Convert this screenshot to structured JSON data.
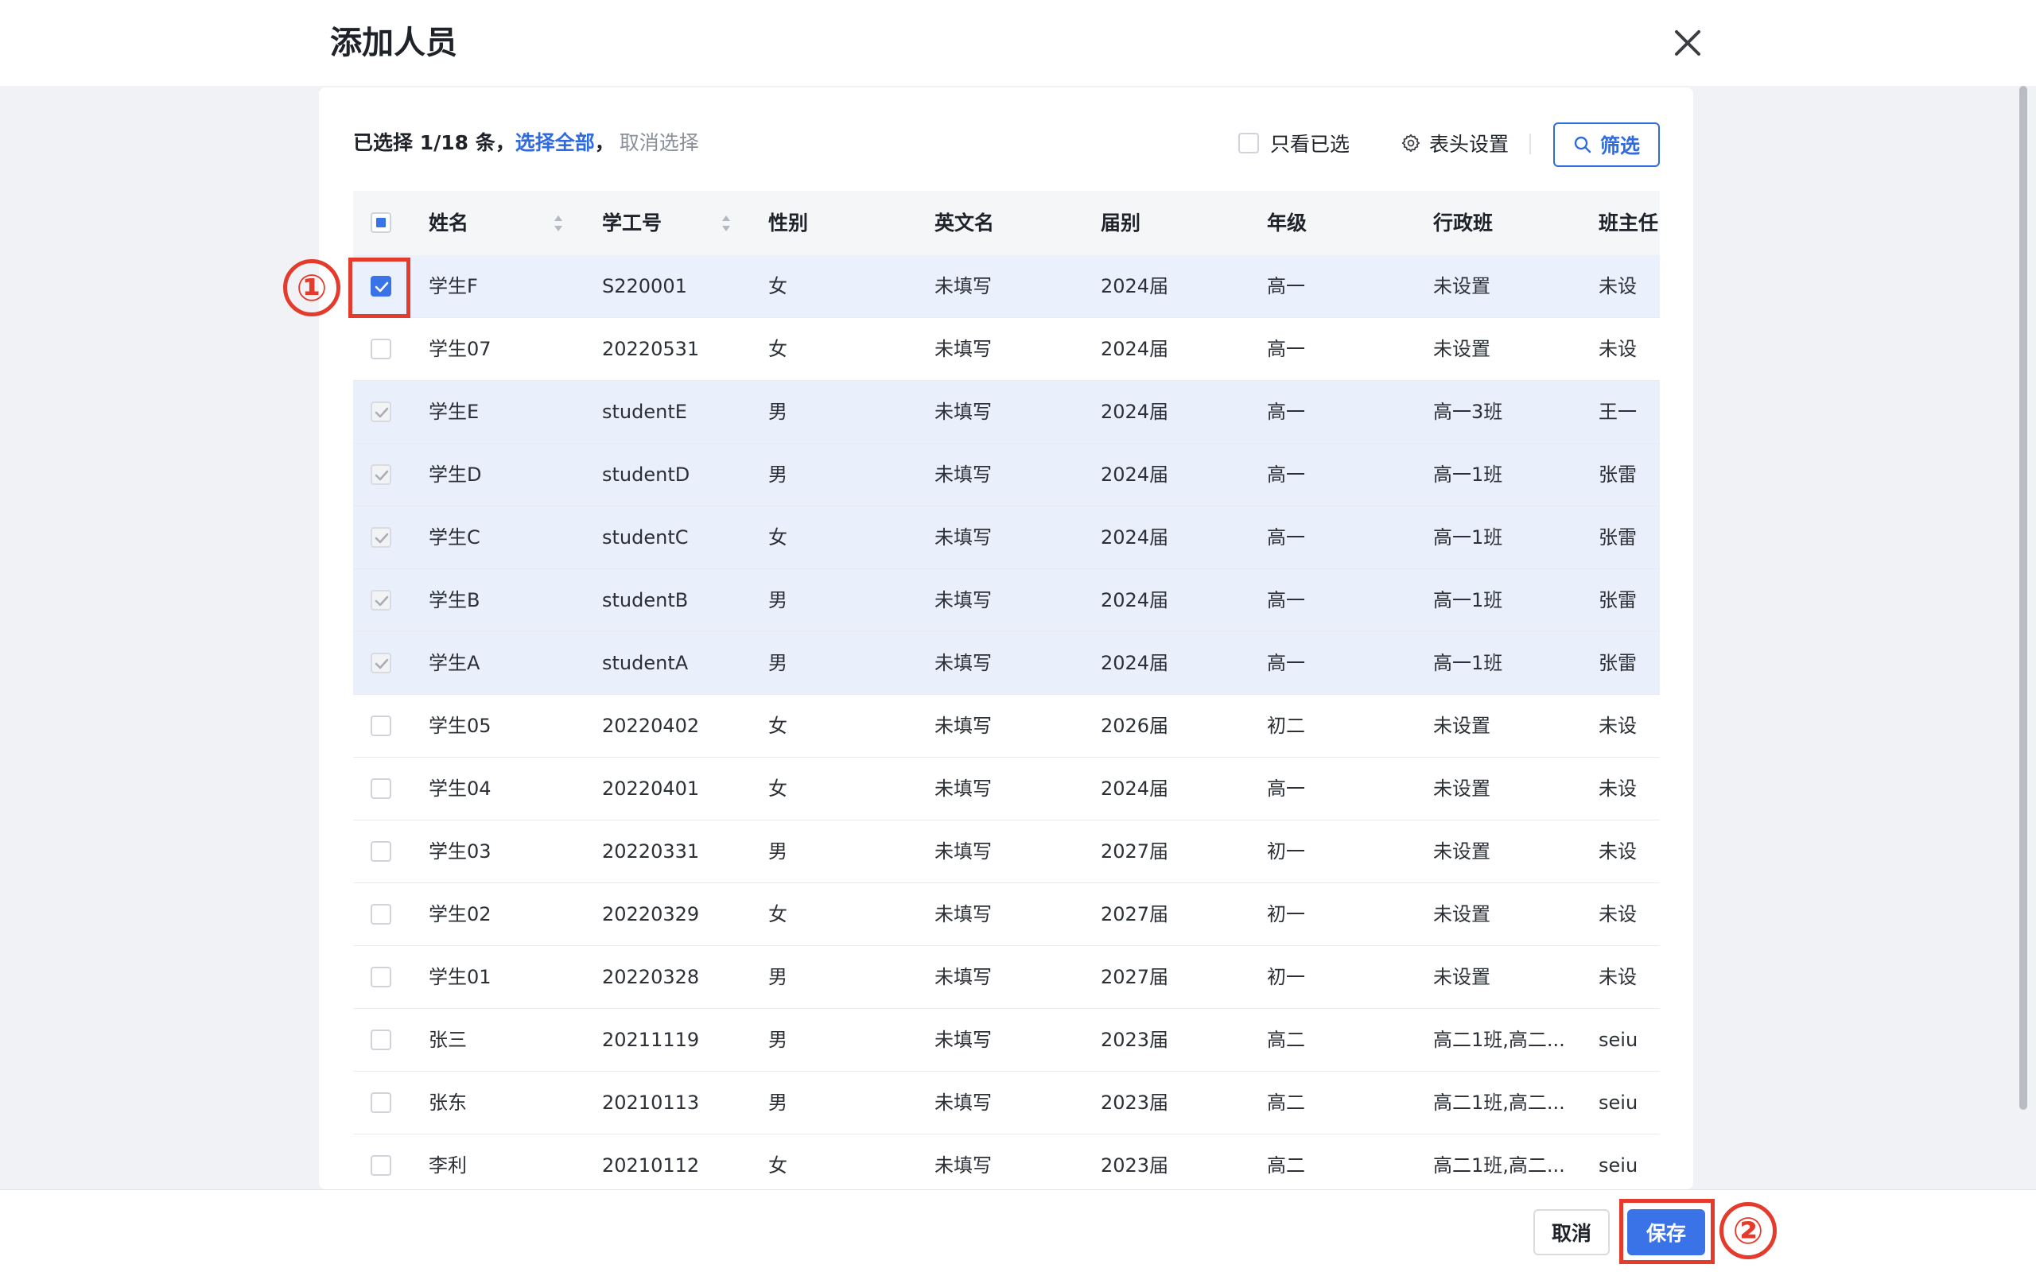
{
  "dialog": {
    "title": "添加人员",
    "close_icon": "close-icon"
  },
  "toolbar": {
    "selection_count": "已选择 1/18 条，",
    "select_all": "选择全部",
    "separator": "，",
    "clear_selection": "取消选择",
    "only_selected_label": "只看已选",
    "only_selected_checked": false,
    "header_settings_label": "表头设置",
    "header_settings_icon": "gear-icon",
    "filter_label": "筛选",
    "filter_icon": "search-icon"
  },
  "table": {
    "columns": [
      "姓名",
      "学工号",
      "性别",
      "英文名",
      "届别",
      "年级",
      "行政班",
      "班主任"
    ],
    "sortable_columns": [
      "姓名",
      "学工号"
    ],
    "header_checkbox_state": "partial",
    "rows": [
      {
        "state": "checked",
        "name": "学生F",
        "id": "S220001",
        "gender": "女",
        "english": "未填写",
        "cohort": "2024届",
        "grade": "高一",
        "class": "未设置",
        "teacher": "未设"
      },
      {
        "state": "unchecked",
        "name": "学生07",
        "id": "20220531",
        "gender": "女",
        "english": "未填写",
        "cohort": "2024届",
        "grade": "高一",
        "class": "未设置",
        "teacher": "未设"
      },
      {
        "state": "disabled",
        "name": "学生E",
        "id": "studentE",
        "gender": "男",
        "english": "未填写",
        "cohort": "2024届",
        "grade": "高一",
        "class": "高一3班",
        "teacher": "王一"
      },
      {
        "state": "disabled",
        "name": "学生D",
        "id": "studentD",
        "gender": "男",
        "english": "未填写",
        "cohort": "2024届",
        "grade": "高一",
        "class": "高一1班",
        "teacher": "张雷"
      },
      {
        "state": "disabled",
        "name": "学生C",
        "id": "studentC",
        "gender": "女",
        "english": "未填写",
        "cohort": "2024届",
        "grade": "高一",
        "class": "高一1班",
        "teacher": "张雷"
      },
      {
        "state": "disabled",
        "name": "学生B",
        "id": "studentB",
        "gender": "男",
        "english": "未填写",
        "cohort": "2024届",
        "grade": "高一",
        "class": "高一1班",
        "teacher": "张雷"
      },
      {
        "state": "disabled",
        "name": "学生A",
        "id": "studentA",
        "gender": "男",
        "english": "未填写",
        "cohort": "2024届",
        "grade": "高一",
        "class": "高一1班",
        "teacher": "张雷"
      },
      {
        "state": "unchecked",
        "name": "学生05",
        "id": "20220402",
        "gender": "女",
        "english": "未填写",
        "cohort": "2026届",
        "grade": "初二",
        "class": "未设置",
        "teacher": "未设"
      },
      {
        "state": "unchecked",
        "name": "学生04",
        "id": "20220401",
        "gender": "女",
        "english": "未填写",
        "cohort": "2024届",
        "grade": "高一",
        "class": "未设置",
        "teacher": "未设"
      },
      {
        "state": "unchecked",
        "name": "学生03",
        "id": "20220331",
        "gender": "男",
        "english": "未填写",
        "cohort": "2027届",
        "grade": "初一",
        "class": "未设置",
        "teacher": "未设"
      },
      {
        "state": "unchecked",
        "name": "学生02",
        "id": "20220329",
        "gender": "女",
        "english": "未填写",
        "cohort": "2027届",
        "grade": "初一",
        "class": "未设置",
        "teacher": "未设"
      },
      {
        "state": "unchecked",
        "name": "学生01",
        "id": "20220328",
        "gender": "男",
        "english": "未填写",
        "cohort": "2027届",
        "grade": "初一",
        "class": "未设置",
        "teacher": "未设"
      },
      {
        "state": "unchecked",
        "name": "张三",
        "id": "20211119",
        "gender": "男",
        "english": "未填写",
        "cohort": "2023届",
        "grade": "高二",
        "class": "高二1班,高二...",
        "teacher": "seiu"
      },
      {
        "state": "unchecked",
        "name": "张东",
        "id": "20210113",
        "gender": "男",
        "english": "未填写",
        "cohort": "2023届",
        "grade": "高二",
        "class": "高二1班,高二...",
        "teacher": "seiu"
      },
      {
        "state": "unchecked",
        "name": "李利",
        "id": "20210112",
        "gender": "女",
        "english": "未填写",
        "cohort": "2023届",
        "grade": "高二",
        "class": "高二1班,高二...",
        "teacher": "seiu"
      }
    ]
  },
  "footer": {
    "cancel_label": "取消",
    "save_label": "保存"
  },
  "annotations": {
    "marker_1": "①",
    "marker_2": "②",
    "highlight_color": "#e53b2c"
  },
  "colors": {
    "accent": "#3a73e8",
    "link": "#2f6bde",
    "selected_row": "#eaf1fd"
  }
}
